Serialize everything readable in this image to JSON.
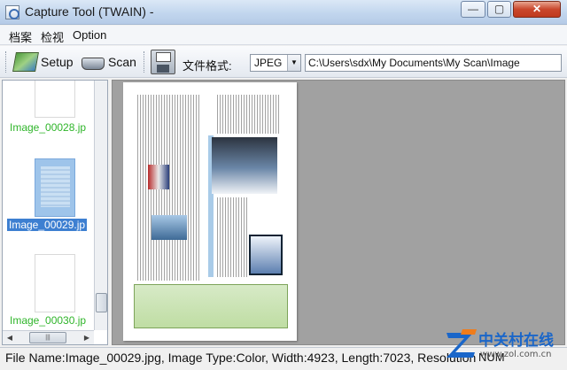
{
  "window": {
    "title": "Capture Tool (TWAIN) -",
    "min_glyph": "—",
    "max_glyph": "▢",
    "close_glyph": "✕"
  },
  "menu": {
    "items": [
      {
        "label": "档案"
      },
      {
        "label": "检视"
      },
      {
        "label": "Option"
      }
    ]
  },
  "toolbar": {
    "setup_label": "Setup",
    "scan_label": "Scan",
    "format_label": "文件格式:",
    "format_value": "JPEG",
    "path_value": "C:\\Users\\sdx\\My Documents\\My Scan\\Image",
    "icons": [
      "setup-icon",
      "scanner-icon",
      "save-icon"
    ]
  },
  "thumbnails": {
    "items": [
      {
        "label": "Image_00028.jp",
        "selected": false
      },
      {
        "label": "Image_00029.jp",
        "selected": true
      },
      {
        "label": "Image_00030.jp",
        "selected": false
      }
    ]
  },
  "status": {
    "text": "File Name:Image_00029.jpg, Image Type:Color, Width:4923, Length:7023, Resolution",
    "num": "NUM"
  },
  "watermark": {
    "text": "中关村在线",
    "url": "www.zol.com.cn"
  },
  "colors": {
    "thumb_label": "#2fb52a",
    "selection": "#3d7fd1",
    "close_button": "#c9472c",
    "watermark": "#1a66c9"
  }
}
